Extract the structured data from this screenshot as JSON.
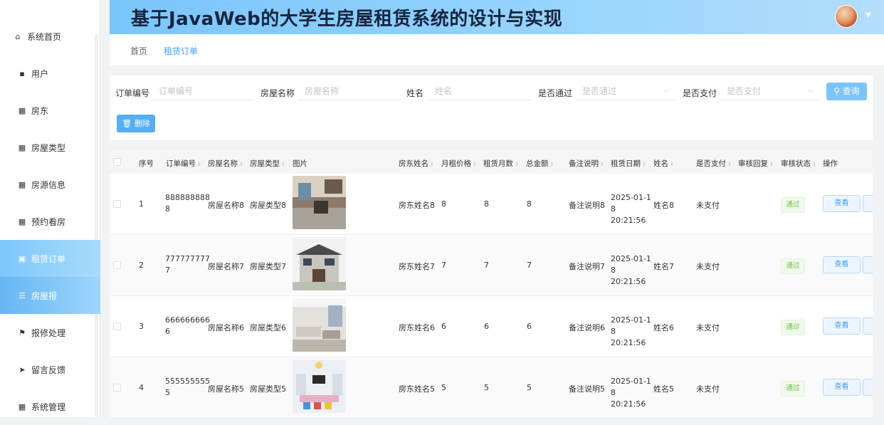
{
  "header": {
    "title": "基于JavaWeb的大学生房屋租赁系统的设计与实现"
  },
  "sidebar": {
    "items": [
      {
        "label": "系统首页",
        "icon": "home-icon"
      },
      {
        "label": "用户",
        "icon": "user-icon"
      },
      {
        "label": "房东",
        "icon": "grid-icon"
      },
      {
        "label": "房屋类型",
        "icon": "grid-icon"
      },
      {
        "label": "房源信息",
        "icon": "grid-icon"
      },
      {
        "label": "预约看房",
        "icon": "grid-icon"
      },
      {
        "label": "租赁订单",
        "icon": "briefcase-icon"
      },
      {
        "label": "房屋报",
        "icon": "list-icon"
      },
      {
        "label": "报修处理",
        "icon": "flag-icon"
      },
      {
        "label": "留言反馈",
        "icon": "send-icon"
      },
      {
        "label": "系统管理",
        "icon": "grid-icon"
      }
    ]
  },
  "breadcrumb": {
    "home": "首页",
    "current": "租赁订单"
  },
  "search": {
    "order_no_label": "订单编号",
    "order_no_placeholder": "订单编号",
    "house_name_label": "房屋名称",
    "house_name_placeholder": "房屋名称",
    "name_label": "姓名",
    "name_placeholder": "姓名",
    "approved_label": "是否通过",
    "approved_placeholder": "是否通过",
    "paid_label": "是否支付",
    "paid_placeholder": "是否支付",
    "query_button": "查询",
    "delete_button": "删除"
  },
  "table": {
    "headers": {
      "index": "序号",
      "order_no": "订单编号",
      "house_name": "房屋名称",
      "house_type": "房屋类型",
      "image": "图片",
      "landlord": "房东姓名",
      "rent": "月租价格",
      "months": "租赁月数",
      "total": "总金额",
      "remark": "备注说明",
      "date": "租赁日期",
      "name": "姓名",
      "paid": "是否支付",
      "reply": "审核回复",
      "status": "审核状态",
      "action": "操作"
    },
    "rows": [
      {
        "index": "1",
        "order_no": "888888888 8",
        "house_name": "房屋名称8",
        "house_type": "房屋类型8",
        "landlord": "房东姓名8",
        "rent": "8",
        "months": "8",
        "total": "8",
        "remark": "备注说明8",
        "date": "2025-01-1 8 20:21:56",
        "name": "姓名8",
        "paid": "未支付",
        "status": "通过",
        "view": "查看"
      },
      {
        "index": "2",
        "order_no": "777777777 7",
        "house_name": "房屋名称7",
        "house_type": "房屋类型7",
        "landlord": "房东姓名7",
        "rent": "7",
        "months": "7",
        "total": "7",
        "remark": "备注说明7",
        "date": "2025-01-1 8 20:21:56",
        "name": "姓名7",
        "paid": "未支付",
        "status": "通过",
        "view": "查看"
      },
      {
        "index": "3",
        "order_no": "666666666 6",
        "house_name": "房屋名称6",
        "house_type": "房屋类型6",
        "landlord": "房东姓名6",
        "rent": "6",
        "months": "6",
        "total": "6",
        "remark": "备注说明6",
        "date": "2025-01-1 8 20:21:56",
        "name": "姓名6",
        "paid": "未支付",
        "status": "通过",
        "view": "查看"
      },
      {
        "index": "4",
        "order_no": "555555555 5",
        "house_name": "房屋名称5",
        "house_type": "房屋类型5",
        "landlord": "房东姓名5",
        "rent": "5",
        "months": "5",
        "total": "5",
        "remark": "备注说明5",
        "date": "2025-01-1 8 20:21:56",
        "name": "姓名5",
        "paid": "未支付",
        "status": "通过",
        "view": "查看"
      }
    ]
  },
  "colors": {
    "accent": "#409eff",
    "header_start": "#7ac5fb",
    "sidebar_active": "#7dc7fb",
    "badge_green": "#67c23a"
  }
}
